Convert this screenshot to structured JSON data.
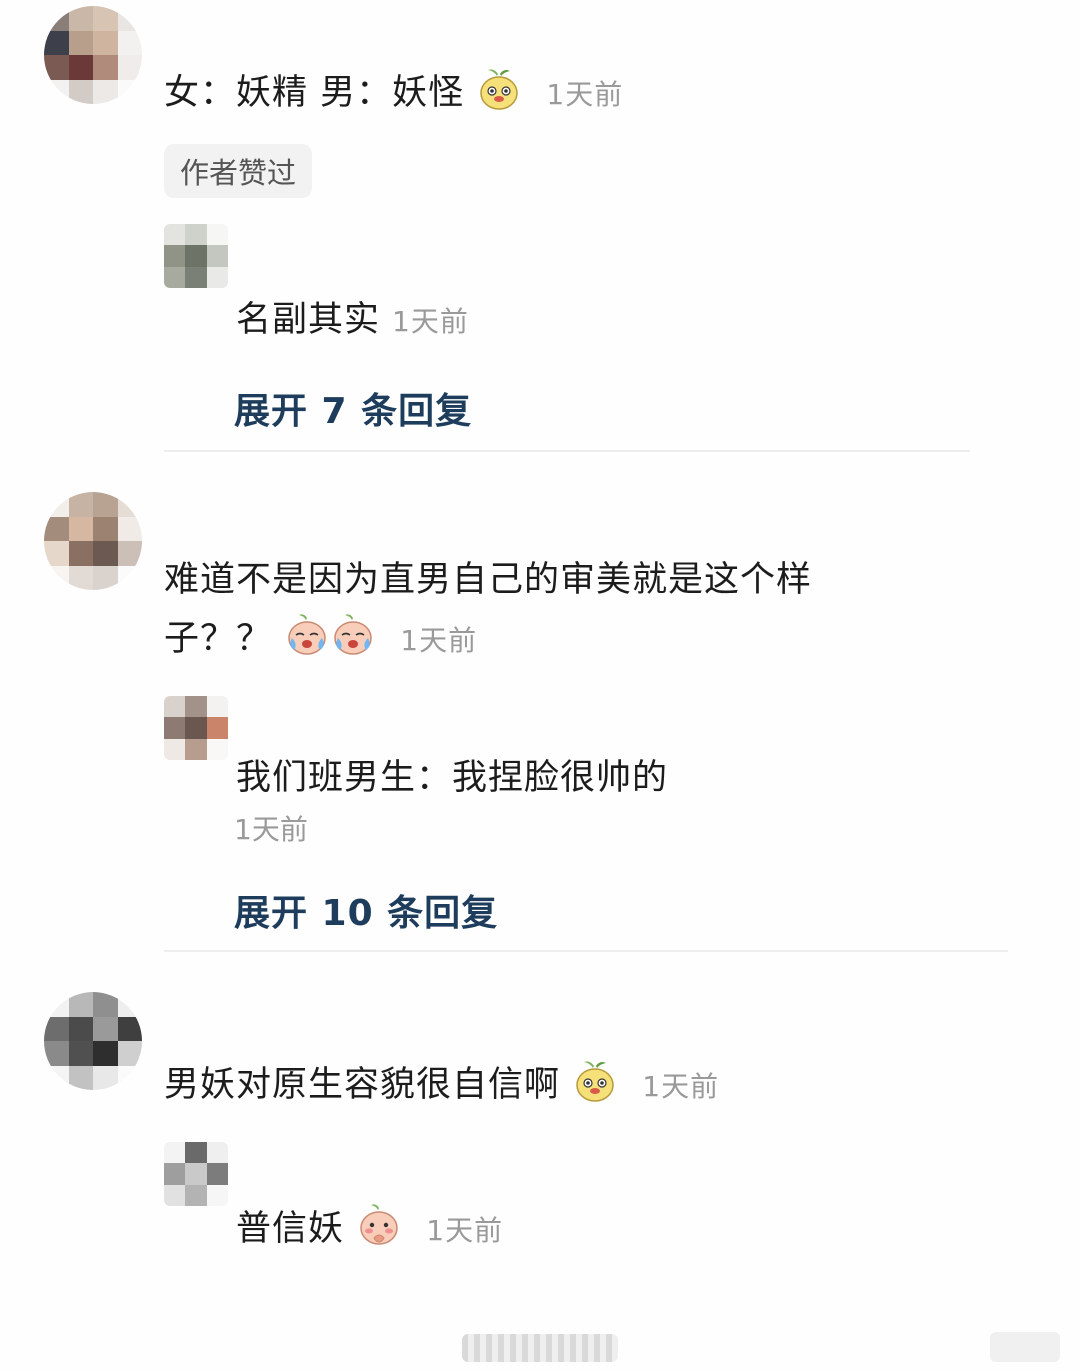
{
  "comments": [
    {
      "text": "女：妖精  男：妖怪",
      "time": "1天前",
      "badge": "作者赞过",
      "emoji": "pear-smile-icon",
      "reply": {
        "text": "名副其实",
        "time": "1天前"
      },
      "expand": "展开 7 条回复"
    },
    {
      "text_line1": "难道不是因为直男自己的审美就是这个样",
      "text_line2": "子？？",
      "time": "1天前",
      "emoji": "crying-face-icon",
      "reply": {
        "text": "我们班男生：我捏脸很帅的",
        "time": "1天前"
      },
      "expand": "展开 10 条回复"
    },
    {
      "text": "男妖对原生容貌很自信啊",
      "time": "1天前",
      "emoji": "pear-smile-icon",
      "reply": {
        "text": "普信妖",
        "time": "1天前",
        "emoji": "shy-face-icon"
      }
    }
  ]
}
